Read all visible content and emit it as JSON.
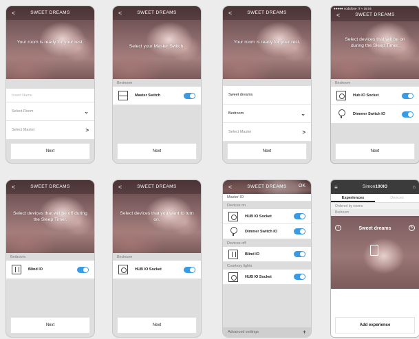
{
  "app": {
    "screen_title": "SWEET DREAMS",
    "back_glyph": "<",
    "ok_label": "OK",
    "next_label": "Next",
    "chevron_down": "⌄",
    "chevron_right": ">"
  },
  "screens": {
    "s1": {
      "message": "Your room is ready for your rest.",
      "name_placeholder": "Insert Name",
      "select_room": "Select Room",
      "select_master": "Select Master"
    },
    "s2": {
      "message": "Select your Master Switch.",
      "section": "Bedroom",
      "device": "Master Switch"
    },
    "s3": {
      "message": "Your room is ready for your rest.",
      "name_value": "Sweet dreams",
      "room_value": "Bedroom",
      "select_master": "Select Master"
    },
    "s4": {
      "status": "●●●●● vodafone IT  ≈    16:04",
      "message": "Select devices that will be on during the Sleep Timer.",
      "section": "Bedroom",
      "devices": [
        "Hub IO Socket",
        "Dimmer Switch IO"
      ]
    },
    "s5": {
      "message": "Select devices that will be off during the Sleep Timer.",
      "section": "Bedroom",
      "device": "Blind IO"
    },
    "s6": {
      "message": "Select devices that you want to turn on.",
      "section": "Bedroom",
      "device": "HUB IO Socket"
    },
    "s7": {
      "partial_item": "Master IO",
      "sections": [
        "Devices on",
        "Devices off",
        "Courtesy lights"
      ],
      "devices_on": [
        "HUB IO Socket",
        "Dimmer Switch IO"
      ],
      "devices_off": [
        "Blind IO"
      ],
      "courtesy": [
        "HUB IO Socket"
      ],
      "footer": "Advanced settings",
      "plus": "+"
    },
    "s8": {
      "menu_glyph": "≡",
      "brand_prefix": "Simon",
      "brand_bold": "100IO",
      "home_glyph": "⌂",
      "tabs": [
        "Experiences",
        "Devices"
      ],
      "ordered_label": "Ordered by rooms",
      "room_label": "Bedroom",
      "card_title": "Sweet dreams",
      "info_glyph": "i",
      "edit_glyph": "✎",
      "add_label": "Add experience"
    }
  },
  "colors": {
    "toggle_on": "#3a9ae4",
    "hero_base": "#8c6a6b",
    "appbar": "#3b3b3b"
  }
}
